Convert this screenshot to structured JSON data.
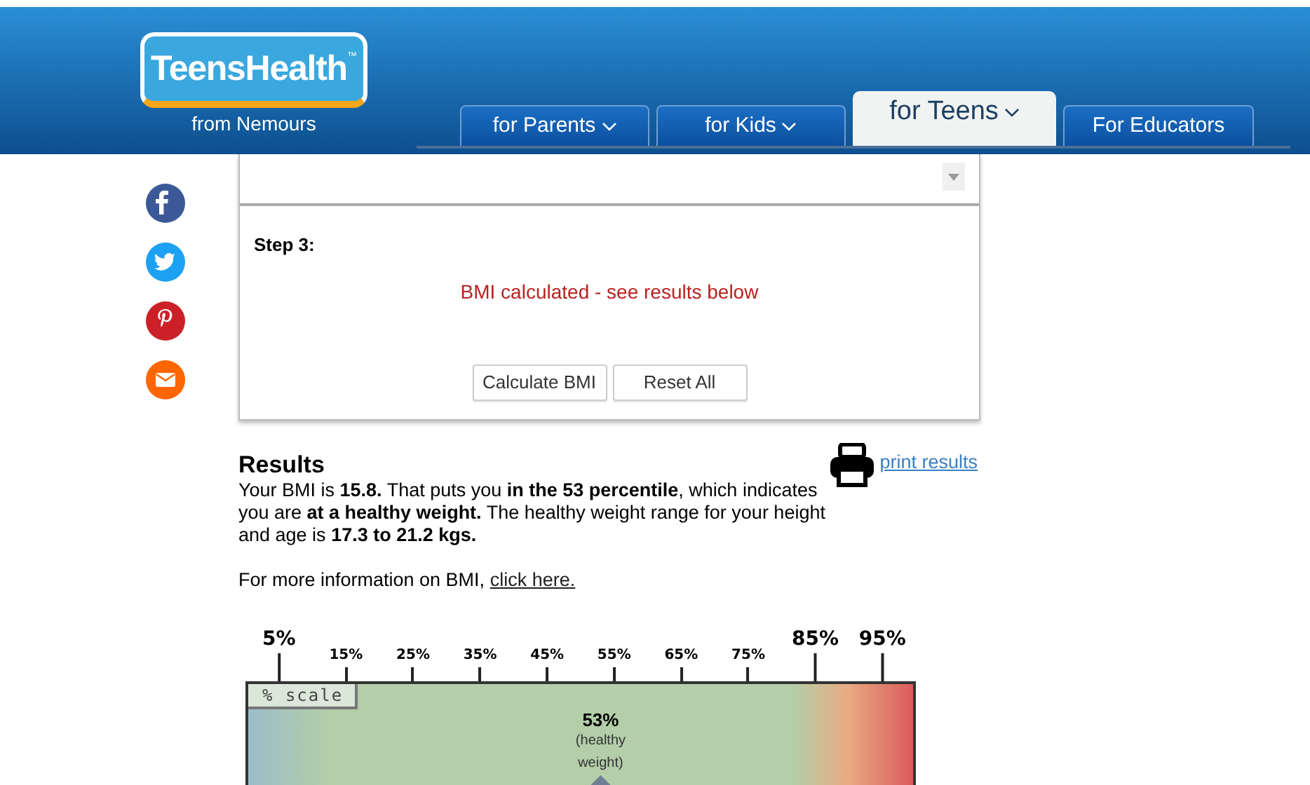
{
  "header": {
    "logo": {
      "title": "TeensHealth",
      "trademark": "™",
      "subtitle": "from Nemours"
    },
    "tabs": [
      {
        "label": "for Parents",
        "selected": false,
        "caret": true
      },
      {
        "label": "for Kids",
        "selected": false,
        "caret": true
      },
      {
        "label": "for Teens",
        "selected": true,
        "caret": true
      },
      {
        "label": "For Educators",
        "selected": false,
        "caret": false
      }
    ]
  },
  "share": [
    {
      "kind": "facebook",
      "color": "#3b5998"
    },
    {
      "kind": "twitter",
      "color": "#1da1f2"
    },
    {
      "kind": "pinterest",
      "color": "#cb2027"
    },
    {
      "kind": "email",
      "color": "#ff6600"
    }
  ],
  "form": {
    "step_label": "Step 3:",
    "message": "BMI calculated - see results below",
    "buttons": [
      "Calculate BMI",
      "Reset All"
    ]
  },
  "results": {
    "title": "Results",
    "print_link": "print results",
    "summary": "Your BMI is **15.8.** That puts you **in the 53 percentile**, which indicates you are **at a healthy weight.** The healthy weight range for your height and age is **17.3 to 21.2 kgs.**",
    "more_info": "For more information on BMI,",
    "more_link": "click here."
  },
  "scale": {
    "ticks": [
      {
        "label": "5%",
        "major": true
      },
      {
        "label": "15%",
        "major": false
      },
      {
        "label": "25%",
        "major": false
      },
      {
        "label": "35%",
        "major": false
      },
      {
        "label": "45%",
        "major": false
      },
      {
        "label": "55%",
        "major": false
      },
      {
        "label": "65%",
        "major": false
      },
      {
        "label": "75%",
        "major": false
      },
      {
        "label": "85%",
        "major": true
      },
      {
        "label": "95%",
        "major": true
      }
    ],
    "tag": "% scale",
    "marker": {
      "value": "53%",
      "note": [
        "(healthy",
        "weight)"
      ],
      "level": 0.53
    }
  }
}
